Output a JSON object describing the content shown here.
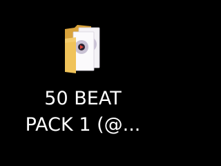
{
  "desktop": {
    "background_color": "#000000",
    "icon": {
      "type": "folder",
      "icon_name": "folder-with-media-files-icon",
      "label_lines": [
        "50 BEAT",
        "PACK 1 (@..."
      ],
      "folder_color": "#f0c35a",
      "folder_back_color": "#d9a33c",
      "disc_color": "#c9c2d4",
      "play_color": "#e0483c"
    }
  }
}
